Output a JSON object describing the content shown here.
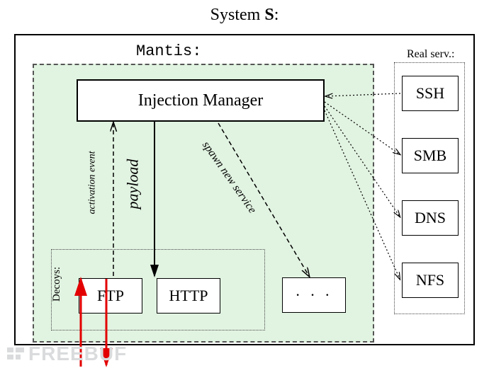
{
  "title_prefix": "System ",
  "title_bold": "S",
  "title_suffix": ":",
  "mantis_label": "Mantis:",
  "injection_manager": "Injection Manager",
  "decoys_label": "Decoys:",
  "decoys": {
    "ftp": "FTP",
    "http": "HTTP",
    "ellipsis": "· · ·"
  },
  "realserv_label": "Real serv.:",
  "real_services": {
    "ssh": "SSH",
    "smb": "SMB",
    "dns": "DNS",
    "nfs": "NFS"
  },
  "edges": {
    "payload": "payload",
    "activation": "activation event",
    "spawn": "spawn new service"
  },
  "watermark": "FREEBUF"
}
